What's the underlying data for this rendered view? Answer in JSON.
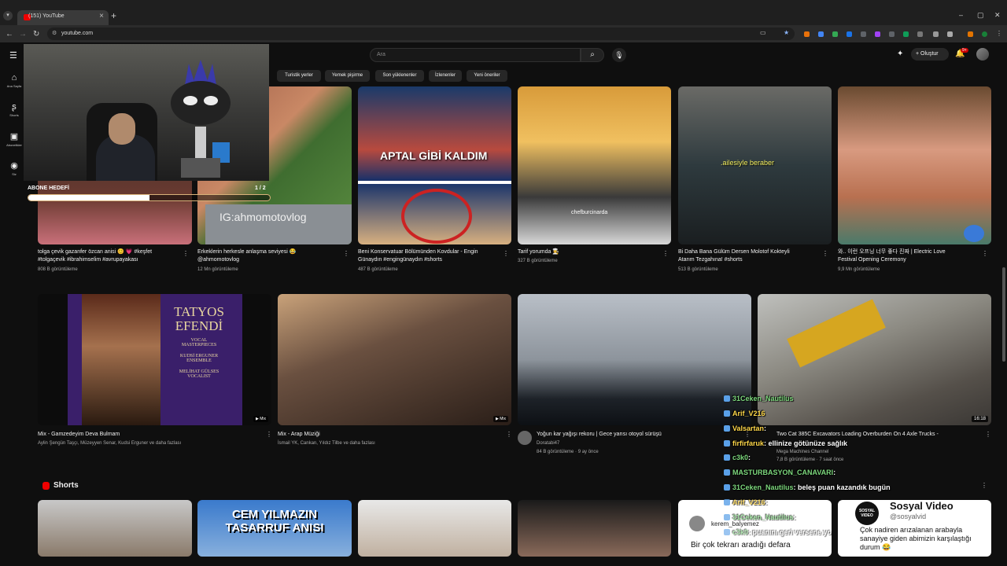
{
  "browser": {
    "tab_title": "(151) YouTube",
    "url": "youtube.com",
    "window_controls": [
      "–",
      "▢",
      "✕"
    ]
  },
  "youtube": {
    "search_placeholder": "Ara",
    "create_label": "Oluştur",
    "notification_count": "9+",
    "sidebar": [
      {
        "icon": "home-icon",
        "glyph": "⌂",
        "label": "Ana Sayfa"
      },
      {
        "icon": "shorts-icon",
        "glyph": "ʂ",
        "label": "Shorts"
      },
      {
        "icon": "subscriptions-icon",
        "glyph": "▣",
        "label": "Abonelikler"
      },
      {
        "icon": "you-icon",
        "glyph": "◉",
        "label": "Siz"
      }
    ],
    "chips": [
      "Turistik yerler",
      "Yemek pişirme",
      "Son yüklenenler",
      "İzlenenler",
      "Yeni öneriler"
    ],
    "row1": [
      {
        "title1": "tolga çevik gazanfer özcan anisi 😊 💗 #keşfet",
        "title2": "#tolgaçevik #ibrahimselim #avrupayakası",
        "meta": "808 B görüntüleme",
        "overlay": ""
      },
      {
        "title1": "Erkeklerin herkesle anlaşma seviyesi 😂",
        "title2": "@ahmomotovlog",
        "meta": "12 Mn görüntüleme",
        "overlay": "IG:ahmomotovlog"
      },
      {
        "title1": "Beni Konservatuar Bölümünden Kovdular - Engin",
        "title2": "Günaydın #engingünaydın #shorts",
        "meta": "487 B görüntüleme",
        "overlay": "APTAL GİBİ KALDIM"
      },
      {
        "title1": "Tarif yorumda 👩‍🍳",
        "title2": "",
        "meta": "327 B görüntüleme",
        "overlay": "chefburcinarda"
      },
      {
        "title1": "Bi Daha Bana Gülüm Dersen Molotof Kokteyli",
        "title2": "Atarım Tezgahına! #shorts",
        "meta": "513 B görüntüleme",
        "overlay": ".ailesiyle beraber"
      },
      {
        "title1": "와.. 이런 오프닝 너무 좋다 진짜 | Electric Love",
        "title2": "Festival Opening Ceremony",
        "meta": "9,9 Mn görüntüleme",
        "overlay": ""
      }
    ],
    "row2": [
      {
        "title": "Mix - Gamzedeyim Deva Bulmam",
        "meta": "Aylin Şengün Taşçı, Müzeyyen Senar, Kudsi Erguner ve daha fazlası",
        "tag": "▶ Mix"
      },
      {
        "title": "Mix - Arap Müziği",
        "meta": "İsmail YK, Cankan, Yıldız Tilbe ve daha fazlası",
        "tag": "▶ Mix"
      },
      {
        "title": "Yoğun kar yağışı rekoru | Gece yarısı otoyol sürüşü",
        "channel": "Doratabi47",
        "meta": "84 B görüntüleme · 9 ay önce"
      },
      {
        "title": "Two Cat 385C Excavators Loading Overburden On 4 Axle Trucks -",
        "channel": "Mega Machines Channel",
        "meta": "7,8 B görüntüleme · 7 saat önce",
        "duration": "16:18"
      }
    ],
    "album_text": [
      "TATYOS",
      "EFENDİ",
      "VOCAL",
      "MASTERPIECES",
      "KUDSİ ERGUNER",
      "ENSEMBLE",
      "MELİHAT GÜLSES",
      "VOCALIST"
    ],
    "shorts_label": "Shorts",
    "shorts_text": [
      "CEM YILMAZIN",
      "TASARRUF ANISI"
    ],
    "sosyal": {
      "name": "Sosyal Video",
      "handle": "@sosyalvid",
      "text1": "Çok nadiren arızalanan arabayla",
      "text2": "sanayiye giden abimizin karşılaştığı",
      "text3": "durum 😂",
      "logo": "SOSYAL VIDEO"
    },
    "kerem": {
      "user": "kerem_balyemez",
      "text": "Bir çok tekrarı aradığı defara"
    }
  },
  "stream": {
    "goal_label": "ABONE HEDEFİ",
    "goal_count": "1 / 2",
    "goal_progress": 0.5,
    "chat": [
      {
        "user": "31Ceken_Nautilus",
        "msg": "",
        "cls": "g"
      },
      {
        "user": "Arif_V216",
        "msg": "",
        "cls": "y"
      },
      {
        "user": "Valsartan",
        "msg": ":",
        "cls": "y"
      },
      {
        "user": "firfirfaruk",
        "msg": ": ellinize götünüze sağlık",
        "cls": "y"
      },
      {
        "user": "c3k0",
        "msg": ":",
        "cls": "g"
      },
      {
        "user": "MASTURBASYON_CANAVARI",
        "msg": ":",
        "cls": "g"
      },
      {
        "user": "31Ceken_Nautilus",
        "msg": ": beleş puan kazandık bugün",
        "cls": "g"
      },
      {
        "user": "Arif_V216",
        "msg": ":",
        "cls": "y"
      },
      {
        "user": "31Ceken_Nautilus",
        "msg": ":",
        "cls": "g"
      },
      {
        "user": "c3k0",
        "msg": ": puanını geri versene yo",
        "cls": "g"
      }
    ]
  }
}
